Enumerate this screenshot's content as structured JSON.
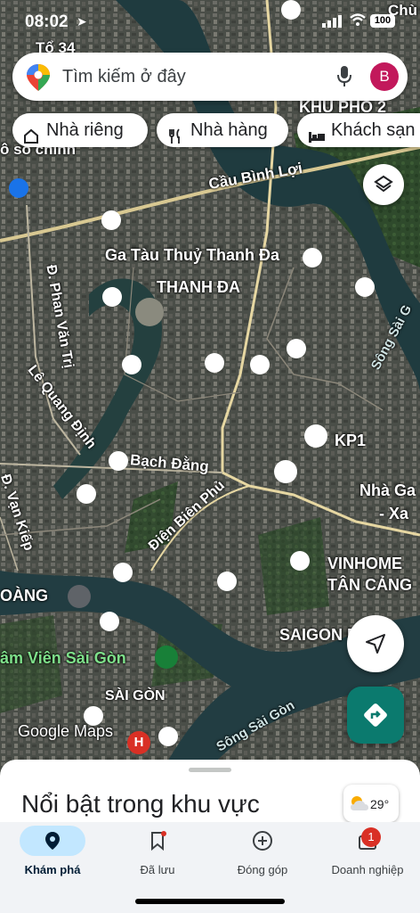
{
  "status_bar": {
    "time": "08:02",
    "battery": "100"
  },
  "search": {
    "placeholder": "Tìm kiếm ở đây",
    "avatar_letter": "B"
  },
  "chips": [
    {
      "label": "Nhà riêng",
      "icon": "home-icon"
    },
    {
      "label": "Nhà hàng",
      "icon": "restaurant-icon"
    },
    {
      "label": "Khách sạn",
      "icon": "hotel-icon"
    }
  ],
  "map_labels": {
    "top_left": "Tổ 34",
    "khu_pho": "KHU PHỐ 2",
    "chu": "Chù",
    "so_chinh": "ô số chính",
    "bridge": "Cầu Bình Lợi",
    "pier": "Ga Tàu Thuỷ Thanh Đa",
    "thanh_da": "THANH ĐA",
    "phan_van_tri": "Đ. Phan Văn Trị",
    "le_quang_dinh": "Lê Quang Định",
    "bach_dang": "Bạch Đằng",
    "dien_bien_phu": "Điện Biên Phủ",
    "van_kiep": "Đ. Vạn Kiếp",
    "kp1": "KP1",
    "nha_ga": "Nhà Ga",
    "xa": "- Xa",
    "vinhomes": "VINHOME",
    "tan_cang": "TÂN CẢNG",
    "song_sai_gon_top": "Sông Sài G",
    "hoang": "OÀNG",
    "saigon_pearl": "SAIGON PEARL",
    "thao_cam_vien": "âm Viên Sài Gòn",
    "sai_gon": "SÀI GÒN",
    "song_sai_gon_bottom": "Sông Sài Gòn",
    "google_maps": "Google Maps"
  },
  "sheet": {
    "title": "Nổi bật trong khu vực"
  },
  "weather": {
    "temperature": "29°",
    "icon": "partly-cloudy-icon"
  },
  "nav": [
    {
      "label": "Khám phá",
      "icon": "explore-pin-icon",
      "active": true
    },
    {
      "label": "Đã lưu",
      "icon": "bookmark-icon"
    },
    {
      "label": "Đóng góp",
      "icon": "add-circle-icon"
    },
    {
      "label": "Doanh nghiệp",
      "icon": "business-icon",
      "badge": "1"
    }
  ],
  "colors": {
    "accent": "#c2e7ff",
    "direction_fab": "#0b7a6e",
    "avatar": "#c2185b",
    "badge": "#d93025"
  }
}
